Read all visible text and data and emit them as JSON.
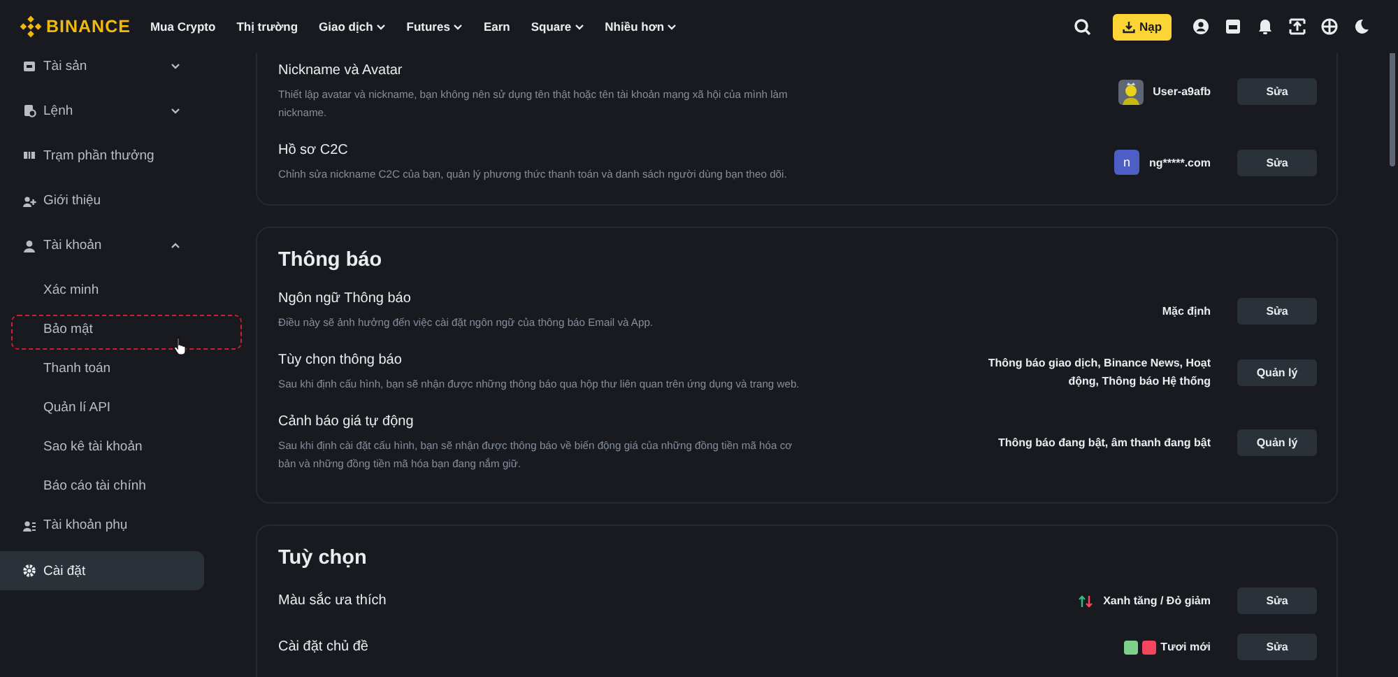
{
  "header": {
    "logo": "BINANCE",
    "nav": [
      {
        "label": "Mua Crypto",
        "dropdown": false
      },
      {
        "label": "Thị trường",
        "dropdown": false
      },
      {
        "label": "Giao dịch",
        "dropdown": true
      },
      {
        "label": "Futures",
        "dropdown": true
      },
      {
        "label": "Earn",
        "dropdown": false
      },
      {
        "label": "Square",
        "dropdown": true
      },
      {
        "label": "Nhiều hơn",
        "dropdown": true
      }
    ],
    "deposit_button": "Nạp"
  },
  "sidebar": {
    "items": [
      {
        "label": "Tài sản",
        "selected": false,
        "expandable": true,
        "expanded": false
      },
      {
        "label": "Lệnh",
        "selected": false,
        "expandable": true,
        "expanded": false
      },
      {
        "label": "Trạm phần thưởng",
        "selected": false,
        "expandable": false
      },
      {
        "label": "Giới thiệu",
        "selected": false,
        "expandable": false
      },
      {
        "label": "Tài khoản",
        "selected": false,
        "expandable": true,
        "expanded": true,
        "children": [
          {
            "label": "Xác minh",
            "highlighted": false,
            "hovered": false
          },
          {
            "label": "Bảo mật",
            "highlighted": true,
            "hovered": true
          },
          {
            "label": "Thanh toán",
            "highlighted": false,
            "hovered": false
          },
          {
            "label": "Quản lí API",
            "highlighted": false,
            "hovered": false
          },
          {
            "label": "Sao kê tài khoản",
            "highlighted": false,
            "hovered": false
          },
          {
            "label": "Báo cáo tài chính",
            "highlighted": false,
            "hovered": false
          }
        ]
      },
      {
        "label": "Tài khoản phụ",
        "selected": false,
        "expandable": false
      },
      {
        "label": "Cài đặt",
        "selected": true,
        "expandable": false
      }
    ]
  },
  "sections": [
    {
      "rows": [
        {
          "title": "Nickname và Avatar",
          "description": "Thiết lập avatar và nickname, bạn không nên sử dụng tên thật hoặc tên tài khoản mạng xã hội của mình làm nickname.",
          "kind": "avatar",
          "value": "User-a9afb",
          "button": "Sửa"
        },
        {
          "title": "Hồ sơ C2C",
          "description": "Chỉnh sửa nickname C2C của bạn, quản lý phương thức thanh toán và danh sách người dùng bạn theo dõi.",
          "kind": "initial",
          "initial": "n",
          "value": "ng*****.com",
          "button": "Sửa"
        }
      ]
    },
    {
      "title": "Thông báo",
      "rows": [
        {
          "title": "Ngôn ngữ Thông báo",
          "description": "Điều này sẽ ảnh hưởng đến việc cài đặt ngôn ngữ của thông báo Email và App.",
          "kind": "text",
          "value": "Mặc định",
          "button": "Sửa"
        },
        {
          "title": "Tùy chọn thông báo",
          "description": "Sau khi định cấu hình, bạn sẽ nhận được những thông báo qua hộp thư liên quan trên ứng dụng và trang web.",
          "kind": "text",
          "value": "Thông báo giao dịch, Binance News, Hoạt động, Thông báo Hệ thống",
          "button": "Quản lý"
        },
        {
          "title": "Cảnh báo giá tự động",
          "description": "Sau khi định cài đặt cấu hình, bạn sẽ nhận được thông báo về biến động giá của những đồng tiền mã hóa cơ bản và những đồng tiền mã hóa bạn đang nắm giữ.",
          "kind": "text",
          "value": "Thông báo đang bật, âm thanh đang bật",
          "button": "Quản lý"
        }
      ]
    },
    {
      "title": "Tuỳ chọn",
      "rows": [
        {
          "title": "Màu sắc ưa thích",
          "kind": "updown",
          "value": "Xanh tăng / Đỏ giảm",
          "button": "Sửa"
        },
        {
          "title": "Cài đặt chủ đề",
          "kind": "theme",
          "swatches": [
            {
              "color": "#7fd08a"
            },
            {
              "color": "#f6465d"
            }
          ],
          "value": "Tươi mới",
          "button": "Sửa"
        }
      ]
    }
  ]
}
